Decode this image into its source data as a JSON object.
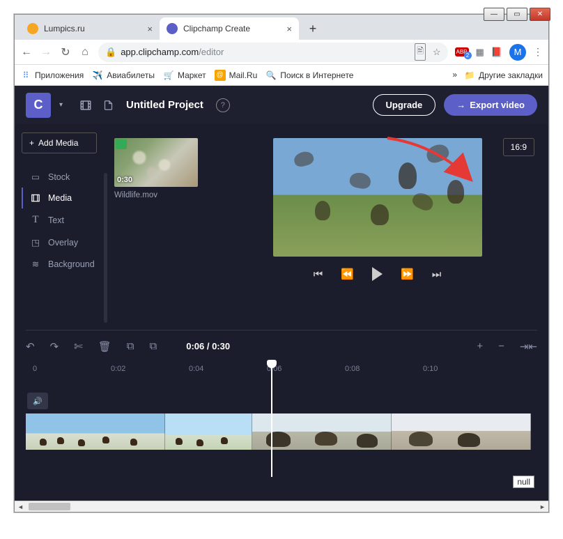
{
  "window": {
    "title": "Clipchamp Create"
  },
  "tabs": [
    {
      "title": "Lumpics.ru",
      "favicon_color": "#f5a623"
    },
    {
      "title": "Clipchamp Create",
      "favicon_color": "#5b5fc7"
    }
  ],
  "url": {
    "lock": "🔒",
    "host": "app.clipchamp.com",
    "path": "/editor"
  },
  "url_icons": {
    "translate": "⠿",
    "star": "☆",
    "abp": "ABP",
    "badge": "2"
  },
  "profile_initial": "M",
  "bookmarks": {
    "apps": "Приложения",
    "items": [
      {
        "icon": "✈️",
        "label": "Авиабилеты"
      },
      {
        "icon": "🛒",
        "label": "Маркет"
      },
      {
        "icon": "@",
        "label": "Mail.Ru"
      },
      {
        "icon": "🔍",
        "label": "Поиск в Интернете"
      }
    ],
    "overflow": "»",
    "other": "Другие закладки"
  },
  "header": {
    "logo": "C",
    "project_title": "Untitled Project",
    "upgrade": "Upgrade",
    "export": "Export video"
  },
  "sidebar": {
    "add_media": "Add Media",
    "items": [
      {
        "icon": "stock",
        "label": "Stock"
      },
      {
        "icon": "media",
        "label": "Media"
      },
      {
        "icon": "text",
        "label": "Text"
      },
      {
        "icon": "overlay",
        "label": "Overlay"
      },
      {
        "icon": "background",
        "label": "Background"
      }
    ],
    "active_index": 1
  },
  "media": {
    "thumb_duration": "0:30",
    "thumb_name": "Wildlife.mov"
  },
  "preview": {
    "ratio": "16:9"
  },
  "timeline": {
    "time": "0:06 / 0:30",
    "ruler": [
      "0",
      "0:02",
      "0:04",
      "0:06",
      "0:08",
      "0:10"
    ]
  },
  "null_label": "null"
}
